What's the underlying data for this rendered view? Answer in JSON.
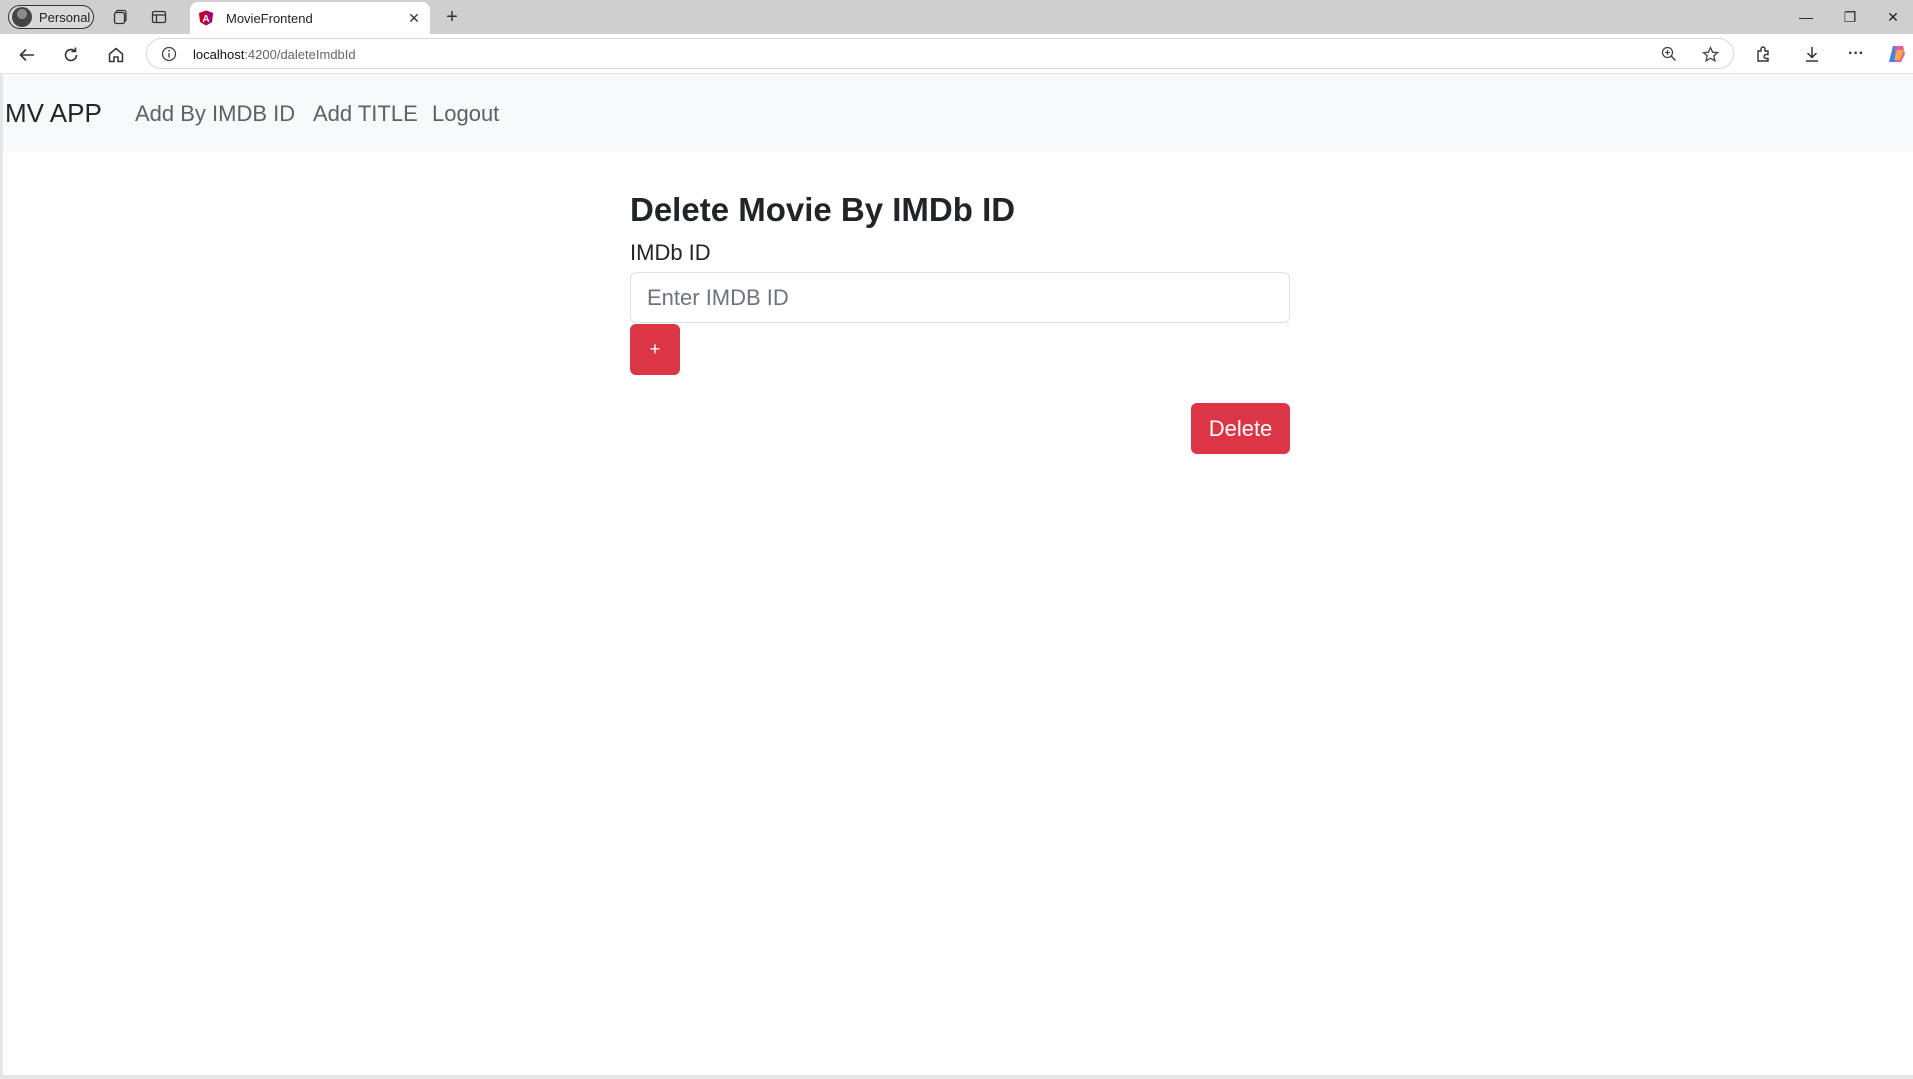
{
  "browser": {
    "profile_label": "Personal",
    "tab_title": "MovieFrontend",
    "url_host": "localhost",
    "url_path": ":4200/daleteImdbId",
    "new_tab_glyph": "+",
    "close_glyph": "✕",
    "minimize_glyph": "—",
    "restore_glyph": "❐",
    "window_close_glyph": "✕",
    "more_glyph": "···"
  },
  "app": {
    "brand": "MV APP",
    "nav_links": [
      "Add By IMDB ID",
      "Add TITLE",
      "Logout"
    ],
    "page_title": "Delete Movie By IMDb ID",
    "field_label": "IMDb ID",
    "input_value": "",
    "input_placeholder": "Enter IMDB ID",
    "add_button_label": "+",
    "delete_button_label": "Delete"
  },
  "colors": {
    "danger": "#dc3545",
    "navbar_bg": "#f8f9fa",
    "text": "#212529",
    "nav_link": "#5c6166"
  },
  "icons": [
    "profile-avatar-icon",
    "workspaces-icon",
    "vertical-tabs-icon",
    "angular-favicon-icon",
    "back-arrow-icon",
    "refresh-icon",
    "home-icon",
    "site-info-icon",
    "zoom-icon",
    "favorite-star-icon",
    "extensions-icon",
    "downloads-icon",
    "more-icon",
    "copilot-icon"
  ]
}
